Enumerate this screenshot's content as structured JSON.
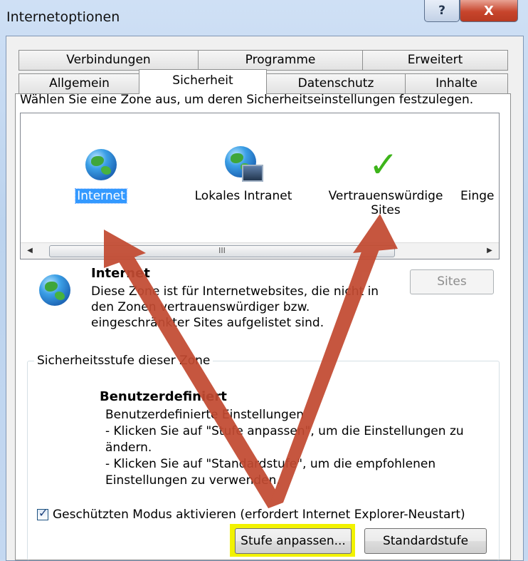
{
  "window": {
    "title": "Internetoptionen",
    "help_label": "?",
    "close_label": "X"
  },
  "tabs": {
    "row1": [
      {
        "label": "Verbindungen"
      },
      {
        "label": "Programme"
      },
      {
        "label": "Erweitert"
      }
    ],
    "row2": [
      {
        "label": "Allgemein"
      },
      {
        "label": "Sicherheit"
      },
      {
        "label": "Datenschutz"
      },
      {
        "label": "Inhalte"
      }
    ],
    "active": "Sicherheit"
  },
  "security": {
    "prompt": "Wählen Sie eine Zone aus, um deren Sicherheitseinstellungen festzulegen.",
    "zones": [
      {
        "label": "Internet",
        "icon": "globe-icon",
        "selected": true
      },
      {
        "label": "Lokales Intranet",
        "icon": "intranet-icon",
        "selected": false
      },
      {
        "label": "Vertrauenswürdige Sites",
        "icon": "checkmark-icon",
        "selected": false
      },
      {
        "label": "Einge",
        "icon": "",
        "selected": false
      }
    ],
    "scroll_thumb_label": "III",
    "selected_zone": {
      "title": "Internet",
      "description": "Diese Zone ist für Internetwebsites, die nicht in den Zonen vertrauenswürdiger bzw. eingeschränkter Sites aufgelistet sind.",
      "sites_button": "Sites"
    },
    "level_group": {
      "label": "Sicherheitsstufe dieser Zone",
      "level_title": "Benutzerdefiniert",
      "level_lines": [
        "Benutzerdefinierte Einstellungen",
        "- Klicken Sie auf \"Stufe anpassen\", um die Einstellungen zu ändern.",
        "- Klicken Sie auf \"Standardstufe\", um die empfohlenen Einstellungen zu verwenden."
      ]
    },
    "protected_mode": {
      "label": "Geschützten Modus aktivieren (erfordert Internet Explorer-Neustart)",
      "checked": true
    },
    "buttons": {
      "custom_level": "Stufe anpassen...",
      "default_level": "Standardstufe"
    }
  },
  "colors": {
    "selection": "#3399ff",
    "annotation_arrow": "#c24a31",
    "highlight": "#f2f200"
  }
}
